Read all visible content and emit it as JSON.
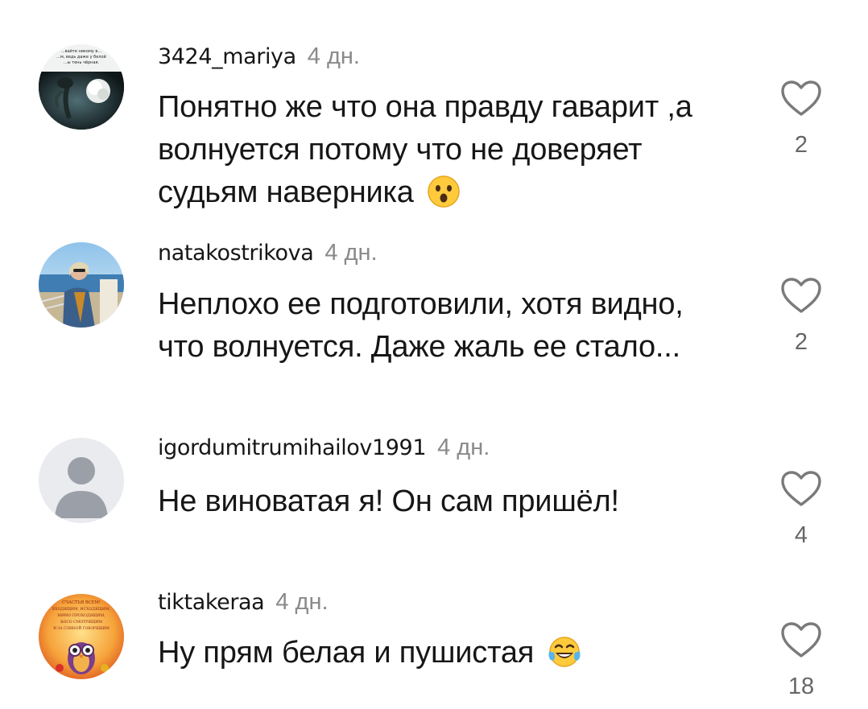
{
  "comments": [
    {
      "username": "3424_mariya",
      "age": "4 дн.",
      "text": "Понятно же что она правду гаварит ,а волнуется потому что не доверяет судьям наверника",
      "emoji": "astonished-face-emoji",
      "likes": "2",
      "avatar": {
        "icon": "rose-avatar",
        "caption_lines": [
          "...вайте никому в...",
          "...м, ведь даже у белой",
          "...ы тень чёрная."
        ]
      }
    },
    {
      "username": "natakostrikova",
      "age": "4 дн.",
      "text": "Неплохо ее подготовили, хотя видно, что волнуется. Даже жаль ее стало...",
      "likes": "2",
      "avatar": {
        "icon": "beach-photo-avatar"
      }
    },
    {
      "username": "igordumitrumihailov1991",
      "age": "4 дн.",
      "text": "Не виноватая я! Он сам пришёл!",
      "likes": "4",
      "avatar": {
        "icon": "default-person-avatar"
      }
    },
    {
      "username": "tiktakeraa",
      "age": "4 дн.",
      "text": "Ну прям белая и пушистая",
      "emoji": "tears-of-joy-emoji",
      "likes": "18",
      "avatar": {
        "icon": "owl-poster-avatar",
        "caption_lines": [
          "СЧАСТЬЯ ВСЕМ!",
          "ВХОДЯЩИМ, ИСХОДЯЩИМ,",
          "МИМО ПРОХОДЯЩИМ,",
          "КОСО СМОТРЯЩИМ",
          "И ЗА СПИНОЙ ГОВОРЯЩИМ"
        ]
      }
    }
  ],
  "colors": {
    "text": "#161616",
    "meta": "#8a8a8a",
    "heart_stroke": "#7a7a7a"
  }
}
